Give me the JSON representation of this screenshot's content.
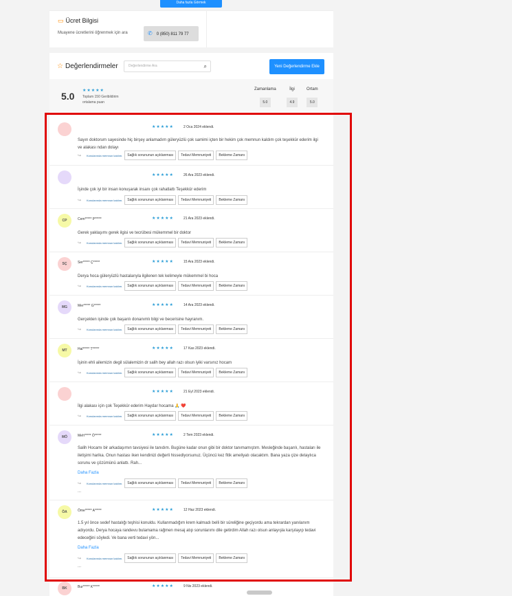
{
  "top_button_label": "Daha fazla Görmek",
  "fee": {
    "title": "Ücret Bilgisi",
    "text": "Muayene ücretlerini öğrenmek için ara",
    "phone": "0 (850) 811 79 77"
  },
  "reviews_header": {
    "title": "Değerlendirmeler",
    "search_placeholder": "Değerlendirme Ara",
    "add_button": "Yeni Değerlendirme Ekle"
  },
  "summary": {
    "score": "5.0",
    "stars": "★★★★★",
    "count_text": "Toplam 150 Geribildirim",
    "avg_text": "ortalama puan",
    "criteria": [
      {
        "label": "Zamanlama",
        "value": "5.0"
      },
      {
        "label": "İlgi",
        "value": "4.9"
      },
      {
        "label": "Ortam",
        "value": "5.0"
      }
    ]
  },
  "tags": {
    "first": "Konularında memnun kaldım.",
    "a": "Sağlık sorununun açıklanması",
    "b": "Tedavi Memnuniyeti",
    "c": "Bekleme Zamanı"
  },
  "reviews": [
    {
      "initials": "",
      "name": "",
      "avatar_color": "#fbd2d2",
      "stars": "★★★★★",
      "date": "2 Oca 2024 eklendi.",
      "text": "Sayın doktorum sayesinde hiç birşey anlamadım güleryüzlü çok samimi içten bir hekim çok memnun kaldım çok teşekkür ederim ilgi ve alakası ndan dolayı"
    },
    {
      "initials": "",
      "name": "",
      "avatar_color": "#e5d9fa",
      "stars": "★★★★★",
      "date": "26 Ara 2023 eklendi.",
      "text": "İşinde çok iyi bir insan konuşarak insanı çok rahatlattı Teşekkür ederim"
    },
    {
      "initials": "CP",
      "name": "Cem***** P*****",
      "avatar_color": "#f6f9a6",
      "stars": "★★★★★",
      "date": "21 Ara 2023 eklendi.",
      "text": "Gerek yaklaşımı gerek ilgisi ve tecrübesi mükemmel bir doktor"
    },
    {
      "initials": "SÇ",
      "name": "Ser***** Ç*****",
      "avatar_color": "#fbd2d2",
      "stars": "★★★★★",
      "date": "15 Ara 2023 eklendi.",
      "text": "Derya hoca güleryüzlü hastalarıyla ilgilenen tek kelimeyle mükemmel bi hoca"
    },
    {
      "initials": "MG",
      "name": "Mer***** G*****",
      "avatar_color": "#e5d9fa",
      "stars": "★★★★★",
      "date": "14 Ara 2023 eklendi.",
      "text": "Gerçekten işinde çok başarılı donanımlı bilgi ve becerisine hayranım."
    },
    {
      "initials": "MT",
      "name": "Hal***** T*****",
      "avatar_color": "#f6f9a6",
      "stars": "★★★★★",
      "date": "17 Kas 2023 eklendi.",
      "text": "İşinin ehli ailemizin degil sülalemizin dr salih bey allah razı olsun iyiki varsınız hocam"
    },
    {
      "initials": "",
      "name": "",
      "avatar_color": "#fbd2d2",
      "stars": "★★★★★",
      "date": "21 Eyl 2023 eklendi.",
      "text": "İlgi alakası için çok Teşekkür ederim Haydar hocama 🙏 ❤️"
    },
    {
      "initials": "MÖ",
      "name": "Meh***** Ö*****",
      "avatar_color": "#e5d9fa",
      "stars": "★★★★★",
      "date": "2 Tem 2023 eklendi.",
      "text": "Salih Hocamı bir arkadaşımın tavsiyesi ile tanıdım. Bugüne kadar onun gibi bir doktor tanımamıştım. Mesleğinde başarılı, hastaları ile iletişimi harika. Onun hastası iken kendinizi değerli hissediyorsunuz. Üçüncü kez fitik ameliyatı olacaktım. Bana yaza çize detaylıca sorunu ve çözümünü anlattı. Rah...",
      "more": "Daha Fazla",
      "dots": "..."
    },
    {
      "initials": "ÖA",
      "name": "Öme***** A*****",
      "avatar_color": "#f6f9a6",
      "stars": "★★★★★",
      "date": "12 Haz 2023 eklendi.",
      "text": "1.5 yıl önce sedef hastalığı teşhisi konuldu. Kullanmadığım krem kalmadı belli bir süreliğine geçiyordu ama tekrardan yanılanım adıyordu. Derya hocaya randevu bulamama rağmen mesaj atıp sorunlarımı dile getirdim Allah razı olsun anlayışla karşılayıp tedavi edeceğini söyledi. Ve bana verti tedavi yön...",
      "more": "Daha Fazla",
      "dots": "..."
    },
    {
      "initials": "BK",
      "name": "Bur***** K*****",
      "avatar_color": "#fbd2d2",
      "stars": "★★★★★",
      "date": "9 Nis 2023 eklendi.",
      "text": ""
    }
  ]
}
